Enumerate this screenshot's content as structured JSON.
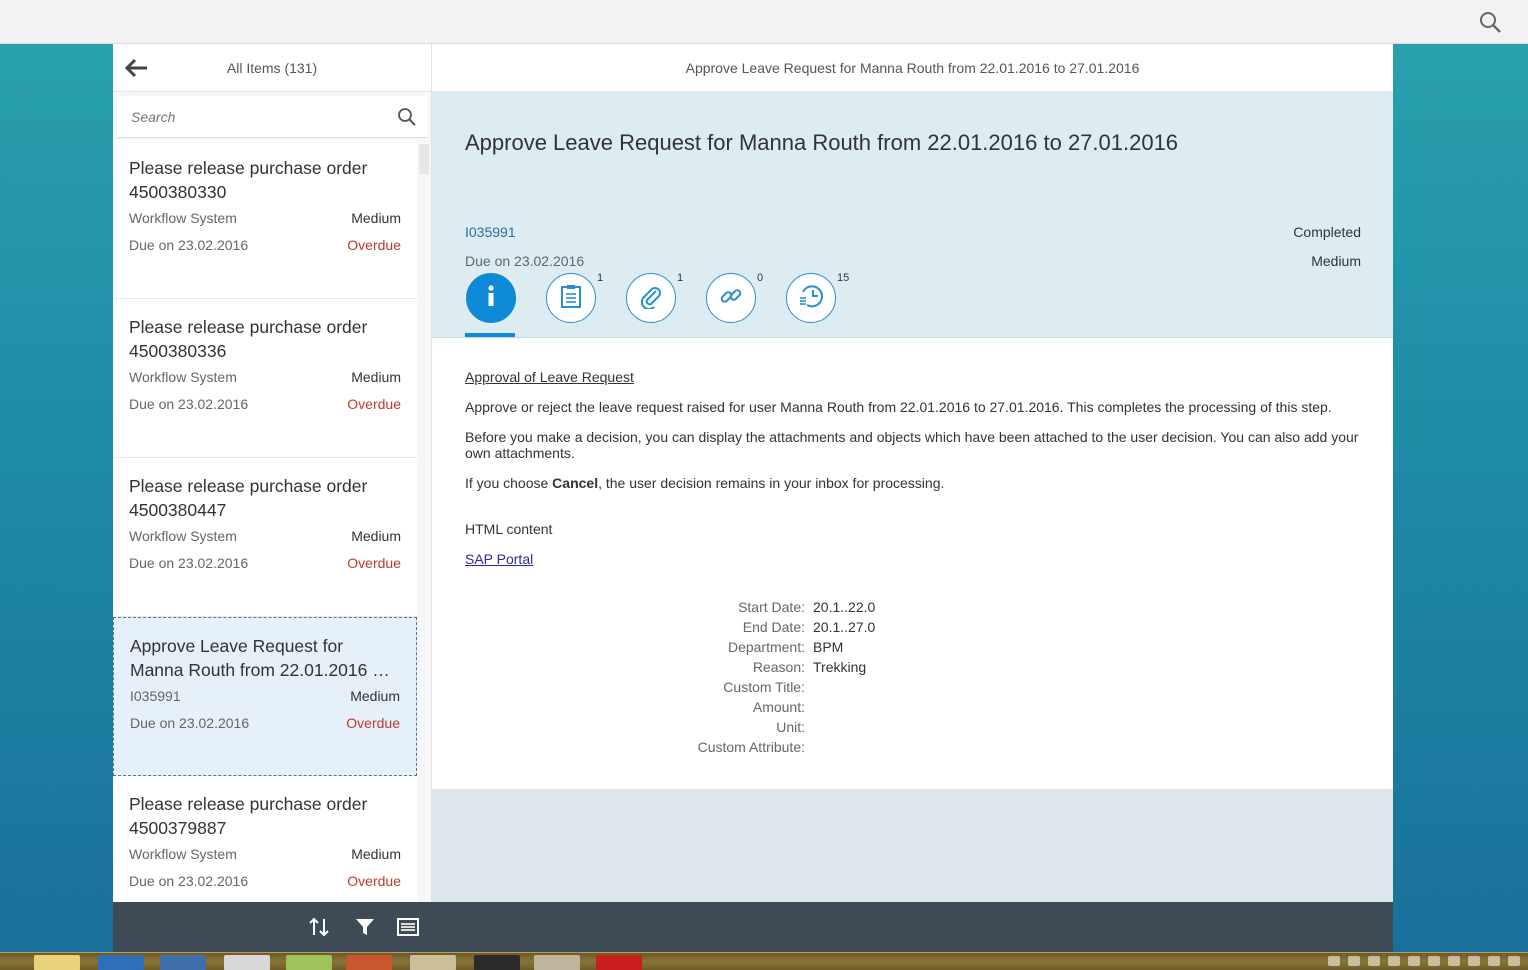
{
  "master": {
    "title": "All Items (131)",
    "search_placeholder": "Search",
    "items": [
      {
        "title": "Please release purchase order 4500380330",
        "creator": "Workflow System",
        "priority": "Medium",
        "due": "Due on 23.02.2016",
        "status": "Overdue"
      },
      {
        "title": "Please release purchase order 4500380336",
        "creator": "Workflow System",
        "priority": "Medium",
        "due": "Due on 23.02.2016",
        "status": "Overdue"
      },
      {
        "title": "Please release purchase order 4500380447",
        "creator": "Workflow System",
        "priority": "Medium",
        "due": "Due on 23.02.2016",
        "status": "Overdue"
      },
      {
        "title": "Approve Leave Request for Manna Routh from 22.01.2016 …",
        "creator": "I035991",
        "priority": "Medium",
        "due": "Due on 23.02.2016",
        "status": "Overdue"
      },
      {
        "title": "Please release purchase order 4500379887",
        "creator": "Workflow System",
        "priority": "Medium",
        "due": "Due on 23.02.2016",
        "status": "Overdue"
      }
    ]
  },
  "detail": {
    "header_title": "Approve Leave Request for Manna Routh from 22.01.2016 to 27.01.2016",
    "object_title": "Approve Leave Request for Manna Routh from 22.01.2016 to 27.01.2016",
    "created_by": "I035991",
    "due": "Due on 23.02.2016",
    "status": "Completed",
    "priority": "Medium",
    "tabs": [
      {
        "icon": "info-icon",
        "count": ""
      },
      {
        "icon": "notes-icon",
        "count": "1"
      },
      {
        "icon": "attachment-icon",
        "count": "1"
      },
      {
        "icon": "link-icon",
        "count": "0"
      },
      {
        "icon": "history-icon",
        "count": "15"
      }
    ],
    "content": {
      "heading": "Approval of Leave Request",
      "para1": "Approve or reject the leave request raised for user Manna Routh from 22.01.2016 to 27.01.2016. This completes the processing of this step.",
      "para2": "Before you make a decision, you can display the attachments and objects which have been attached to the user decision. You can also add your own attachments.",
      "para3_pre": "If you choose ",
      "para3_bold": "Cancel",
      "para3_post": ", the user decision remains in your inbox for processing.",
      "html_content": "HTML content",
      "portal_link": "SAP Portal"
    },
    "fields": [
      {
        "label": "Start Date:",
        "value": "20.1..22.0"
      },
      {
        "label": "End Date:",
        "value": "20.1..27.0"
      },
      {
        "label": "Department:",
        "value": "BPM"
      },
      {
        "label": "Reason:",
        "value": "Trekking"
      },
      {
        "label": "Custom Title:",
        "value": ""
      },
      {
        "label": "Amount:",
        "value": ""
      },
      {
        "label": "Unit:",
        "value": ""
      },
      {
        "label": "Custom Attribute:",
        "value": ""
      }
    ]
  },
  "colors": {
    "accent": "#0f8ad6",
    "overdue": "#c0392b",
    "footer": "#3e4a55",
    "header_bg": "#dcecf0"
  }
}
